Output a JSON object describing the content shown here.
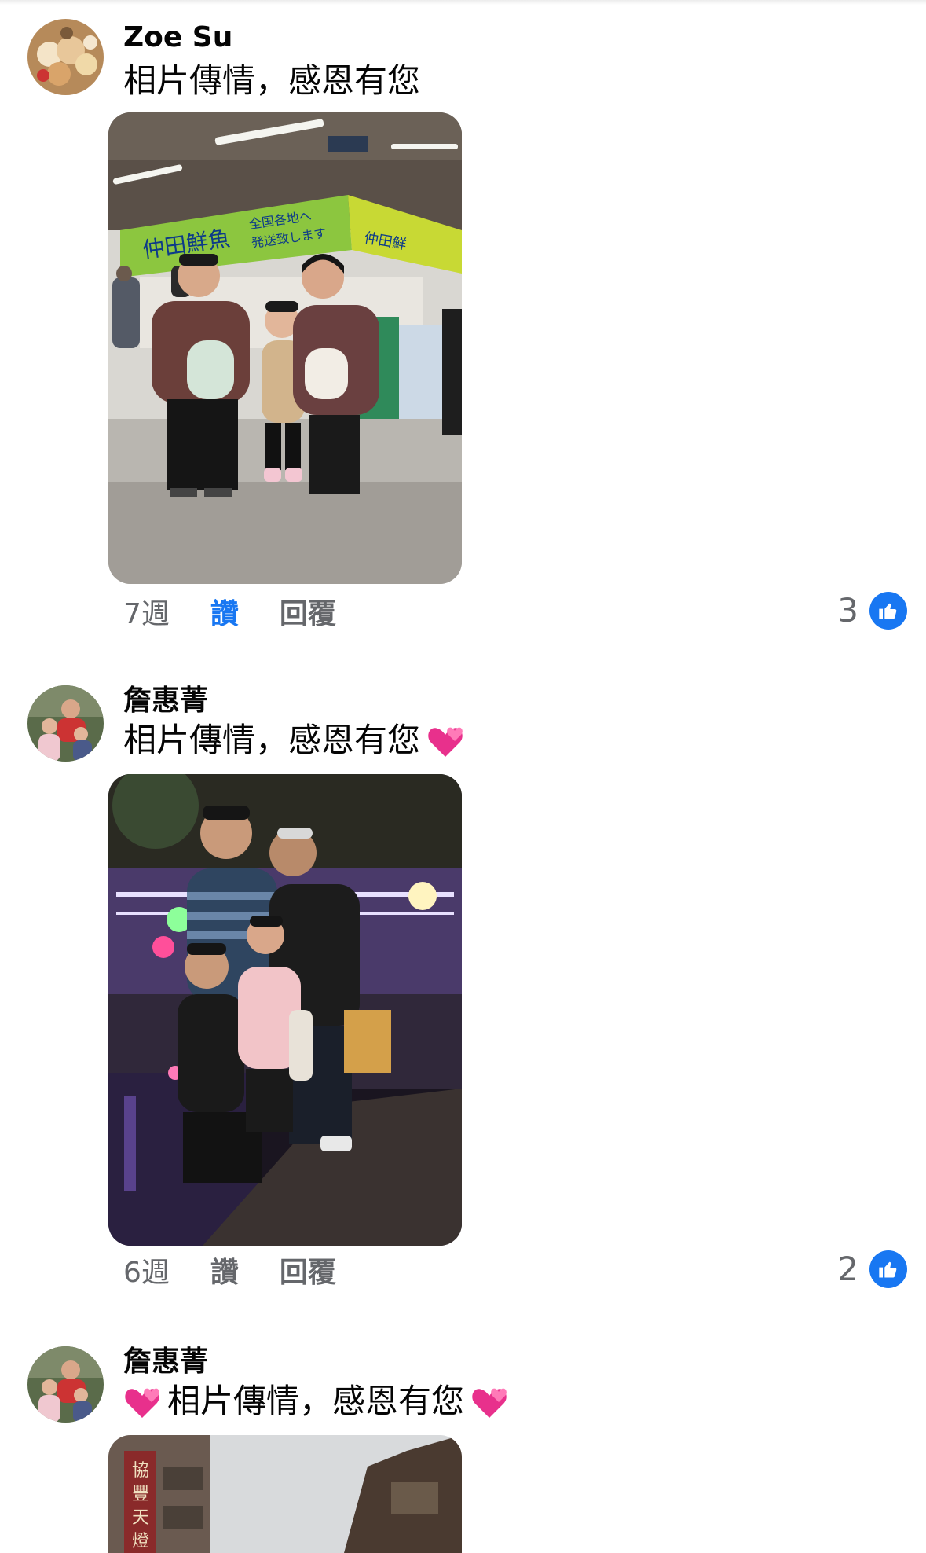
{
  "comments": [
    {
      "author": "Zoe Su",
      "text": "相片傳情，感恩有您",
      "time": "7週",
      "like_label": "讚",
      "like_active": true,
      "reply_label": "回覆",
      "reaction_count": "3"
    },
    {
      "author": "詹惠菁",
      "text": "相片傳情，感恩有您",
      "time": "6週",
      "like_label": "讚",
      "like_active": false,
      "reply_label": "回覆",
      "reaction_count": "2"
    },
    {
      "author": "詹惠菁",
      "text": "相片傳情，感恩有您",
      "time": "",
      "like_label": "",
      "reply_label": "",
      "reaction_count": ""
    }
  ],
  "photos": [
    {
      "signs": [
        "仲田鮮魚",
        "全国各地へ",
        "発送致します"
      ]
    },
    {},
    {
      "signs": [
        "協",
        "豐",
        "天",
        "燈"
      ]
    }
  ],
  "icons": {
    "like_badge": "thumbs-up-icon",
    "emoji": "two-hearts-emoji"
  },
  "colors": {
    "accent": "#1877f2",
    "secondary_text": "#65676b"
  }
}
